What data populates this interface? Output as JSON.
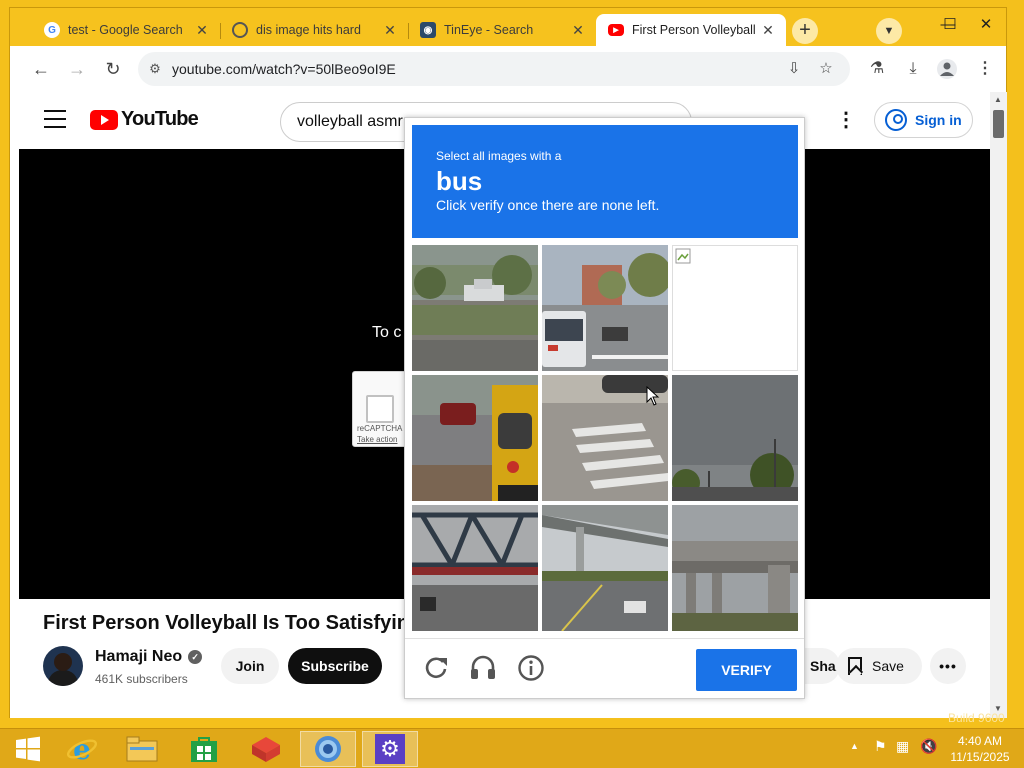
{
  "browser": {
    "tabs": [
      {
        "title": "test - Google Search",
        "icon": "google-icon"
      },
      {
        "title": "dis image hits hard",
        "icon": "globe-icon"
      },
      {
        "title": "TinEye - Search",
        "icon": "tineye-icon"
      },
      {
        "title": "First Person Volleyball",
        "icon": "youtube-icon",
        "active": true
      }
    ],
    "new_tab": "+",
    "url": "youtube.com/watch?v=50lBeo9oI9E",
    "window_controls": {
      "minimize": "—",
      "maximize": "☐",
      "close": "✕"
    }
  },
  "youtube": {
    "logo_text": "YouTube",
    "search_query": "volleyball asmr",
    "sign_in": "Sign in",
    "player_message": "To c",
    "recaptcha_widget": {
      "label": "reCAPTCHA",
      "link": "Take action"
    },
    "video_title": "First Person Volleyball Is Too Satisfying",
    "channel": {
      "name": "Hamaji Neo",
      "subscribers": "461K subscribers"
    },
    "join": "Join",
    "subscribe": "Subscribe",
    "share": "Share",
    "save": "Save"
  },
  "captcha": {
    "instruction_line1": "Select all images with a",
    "target": "bus",
    "instruction_line3": "Click verify once there are none left.",
    "verify": "VERIFY",
    "tiles": [
      {
        "subject": "street with pickup truck",
        "loaded": true
      },
      {
        "subject": "bus on street",
        "loaded": true
      },
      {
        "subject": "broken image",
        "loaded": false
      },
      {
        "subject": "school bus side",
        "loaded": true
      },
      {
        "subject": "crosswalk",
        "loaded": true
      },
      {
        "subject": "road and trees under cloudy sky",
        "loaded": true
      },
      {
        "subject": "bridge truss",
        "loaded": true
      },
      {
        "subject": "highway overpass",
        "loaded": true
      },
      {
        "subject": "overpass pillars",
        "loaded": true
      }
    ]
  },
  "taskbar": {
    "time": "4:40 AM",
    "date": "11/15/2025",
    "watermark": "Build 9600"
  },
  "colors": {
    "desktop": "#f4c01c",
    "captcha_blue": "#1a73e8",
    "youtube_red": "#ff0000",
    "signin_blue": "#065fd4"
  }
}
